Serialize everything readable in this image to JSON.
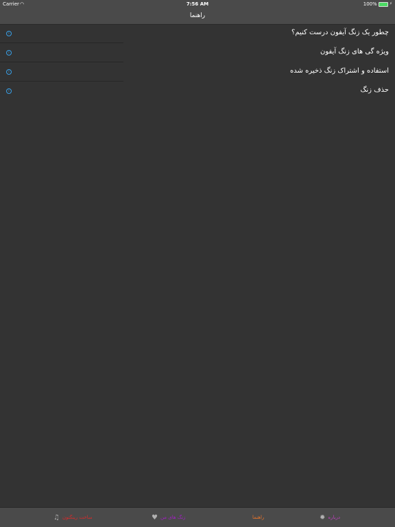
{
  "status": {
    "carrier": "Carrier",
    "time": "7:56 AM",
    "battery_text": "100%",
    "battery_level": 1.0
  },
  "nav": {
    "title": "راهنما"
  },
  "help_items": [
    {
      "label": "چطور یک زنگ آیفون درست کنیم؟"
    },
    {
      "label": "ویژه گی های زنگ آیفون"
    },
    {
      "label": "استفاده و اشتراک زنگ ذخیره شده"
    },
    {
      "label": "حذف زنگ"
    }
  ],
  "tabs": [
    {
      "label": "ساخت رینگتون",
      "icon": "music-note-icon",
      "color": "#d62b2b"
    },
    {
      "label": "زنگ های من",
      "icon": "heart-icon",
      "color": "#a020c0"
    },
    {
      "label": "راهنما",
      "icon": "",
      "color": "#e8742a"
    },
    {
      "label": "درباره",
      "icon": "gear-icon",
      "color": "#c040c0"
    }
  ],
  "colors": {
    "background": "#333333",
    "bar": "#4a4a4a",
    "info_accent": "#38a0e8",
    "battery_green": "#4cd964"
  }
}
